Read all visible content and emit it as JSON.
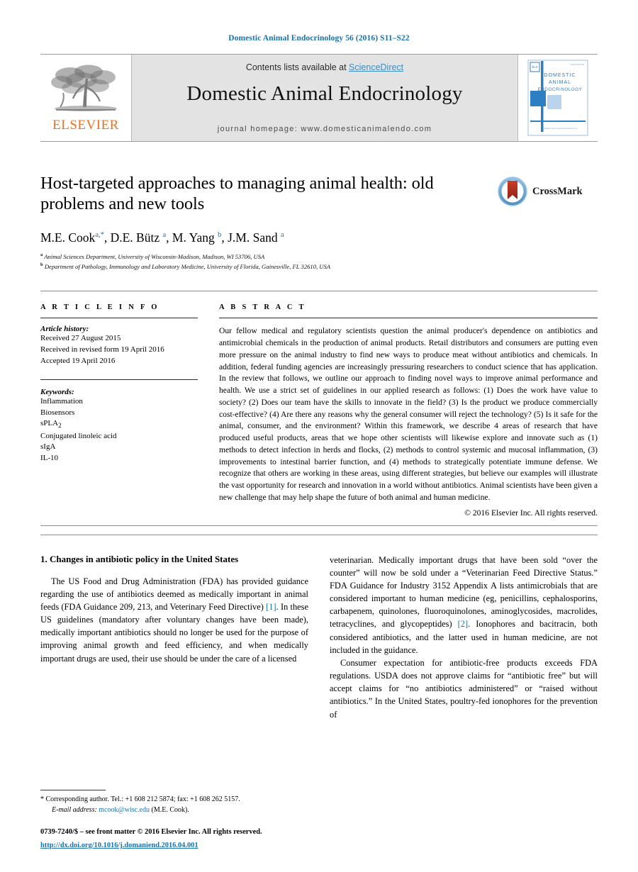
{
  "running_head": "Domestic Animal Endocrinology 56 (2016) S11–S22",
  "masthead": {
    "publisher_logo_name": "elsevier-tree-logo",
    "publisher_wordmark": "ELSEVIER",
    "contents_prefix": "Contents lists available at ",
    "contents_link": "ScienceDirect",
    "journal_title": "Domestic Animal Endocrinology",
    "homepage": "journal homepage: www.domesticanimalendo.com",
    "cover_title_lines": [
      "DOMESTIC",
      "ANIMAL",
      "ENDOCRINOLOGY"
    ],
    "cover_corner_text": "ISSN 0739-7240",
    "cover_footer_text": "Available online at www.sciencedirect.com",
    "colors": {
      "link_blue": "#3a8fc4",
      "header_blue": "#1a72a8",
      "masthead_gray": "#e3e3e3",
      "elsevier_orange": "#E9711C",
      "cover_blue": "#2E7EC4",
      "cover_light_blue": "#B9D4EC"
    }
  },
  "article": {
    "title": "Host-targeted approaches to managing animal health: old problems and new tools",
    "crossmark_label": "CrossMark",
    "authors_html": "M.E. Cook<sup>a,*</sup>, D.E. Bütz <sup>a</sup>, M. Yang <sup>b</sup>, J.M. Sand <sup>a</sup>",
    "affiliations": [
      {
        "marker": "a",
        "text": "Animal Sciences Department, University of Wisconsin-Madison, Madison, WI 53706, USA"
      },
      {
        "marker": "b",
        "text": "Department of Pathology, Immunology and Laboratory Medicine, University of Florida, Gainesville, FL 32610, USA"
      }
    ]
  },
  "article_info": {
    "heading": "A R T I C L E    I N F O",
    "history_title": "Article history:",
    "history": [
      "Received 27 August 2015",
      "Received in revised form 19 April 2016",
      "Accepted 19 April 2016"
    ],
    "keywords_title": "Keywords:",
    "keywords": [
      "Inflammation",
      "Biosensors",
      "sPLA2",
      "Conjugated linoleic acid",
      "sIgA",
      "IL-10"
    ]
  },
  "abstract": {
    "heading": "A B S T R A C T",
    "body": "Our fellow medical and regulatory scientists question the animal producer's dependence on antibiotics and antimicrobial chemicals in the production of animal products. Retail distributors and consumers are putting even more pressure on the animal industry to find new ways to produce meat without antibiotics and chemicals. In addition, federal funding agencies are increasingly pressuring researchers to conduct science that has application. In the review that follows, we outline our approach to finding novel ways to improve animal performance and health. We use a strict set of guidelines in our applied research as follows: (1) Does the work have value to society? (2) Does our team have the skills to innovate in the field? (3) Is the product we produce commercially cost-effective? (4) Are there any reasons why the general consumer will reject the technology? (5) Is it safe for the animal, consumer, and the environment? Within this framework, we describe 4 areas of research that have produced useful products, areas that we hope other scientists will likewise explore and innovate such as (1) methods to detect infection in herds and flocks, (2) methods to control systemic and mucosal inflammation, (3) improvements to intestinal barrier function, and (4) methods to strategically potentiate immune defense. We recognize that others are working in these areas, using different strategies, but believe our examples will illustrate the vast opportunity for research and innovation in a world without antibiotics. Animal scientists have been given a new challenge that may help shape the future of both animal and human medicine.",
    "copyright": "© 2016 Elsevier Inc. All rights reserved."
  },
  "body": {
    "section_number_title": "1. Changes in antibiotic policy in the United States",
    "left_paragraph_1": "The US Food and Drug Administration (FDA) has provided guidance regarding the use of antibiotics deemed as medically important in animal feeds (FDA Guidance 209, 213, and Veterinary Feed Directive) ",
    "left_ref_1": "[1]",
    "left_paragraph_1b": ". In these US guidelines (mandatory after voluntary changes have been made), medically important antibiotics should no longer be used for the purpose of improving animal growth and feed efficiency, and when medically important drugs are used, their use should be under the care of a licensed",
    "right_paragraph_1": "veterinarian. Medically important drugs that have been sold “over the counter” will now be sold under a “Veterinarian Feed Directive Status.” FDA Guidance for Industry 3152 Appendix A lists antimicrobials that are considered important to human medicine (eg, penicillins, cephalosporins, carbapenem, quinolones, fluoroquinolones, aminoglycosides, macrolides, tetracyclines, and glycopeptides) ",
    "right_ref_1": "[2]",
    "right_paragraph_1b": ". Ionophores and bacitracin, both considered antibiotics, and the latter used in human medicine, are not included in the guidance.",
    "right_paragraph_2": "Consumer expectation for antibiotic-free products exceeds FDA regulations. USDA does not approve claims for “antibiotic free” but will accept claims for “no antibiotics administered” or “raised without antibiotics.” In the United States, poultry-fed ionophores for the prevention of"
  },
  "footnotes": {
    "corresponding_marker": "*",
    "corresponding_text": "Corresponding author. Tel.: +1 608 212 5874; fax: +1 608 262 5157.",
    "email_label": "E-mail address:",
    "email": "mcook@wisc.edu",
    "email_owner": "(M.E. Cook).",
    "issn_line": "0739-7240/$ – see front matter © 2016 Elsevier Inc. All rights reserved.",
    "doi": "http://dx.doi.org/10.1016/j.domaniend.2016.04.001"
  }
}
